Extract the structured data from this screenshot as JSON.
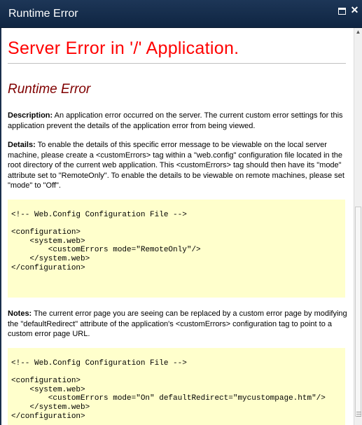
{
  "window": {
    "title": "Runtime Error"
  },
  "heading": "Server Error in '/' Application.",
  "subheading": "Runtime Error",
  "description": {
    "label": "Description:",
    "text": " An application error occurred on the server. The current custom error settings for this application prevent the details of the application error from being viewed."
  },
  "details": {
    "label": "Details:",
    "text": " To enable the details of this specific error message to be viewable on the local server machine, please create a <customErrors> tag within a \"web.config\" configuration file located in the root directory of the current web application. This <customErrors> tag should then have its \"mode\" attribute set to \"RemoteOnly\". To enable the details to be viewable on remote machines, please set \"mode\" to \"Off\"."
  },
  "code1": "<!-- Web.Config Configuration File -->\n\n<configuration>\n    <system.web>\n        <customErrors mode=\"RemoteOnly\"/>\n    </system.web>\n</configuration>",
  "notes": {
    "label": "Notes:",
    "text": " The current error page you are seeing can be replaced by a custom error page by modifying the \"defaultRedirect\" attribute of the application's <customErrors> configuration tag to point to a custom error page URL."
  },
  "code2": "<!-- Web.Config Configuration File -->\n\n<configuration>\n    <system.web>\n        <customErrors mode=\"On\" defaultRedirect=\"mycustompage.htm\"/>\n    </system.web>\n</configuration>",
  "colors": {
    "title_bar": "#1d3657",
    "heading": "#ff0000",
    "subheading": "#800000",
    "code_bg": "#ffffcc"
  },
  "icons": {
    "maximize": "maximize-icon",
    "close": "close-icon"
  }
}
